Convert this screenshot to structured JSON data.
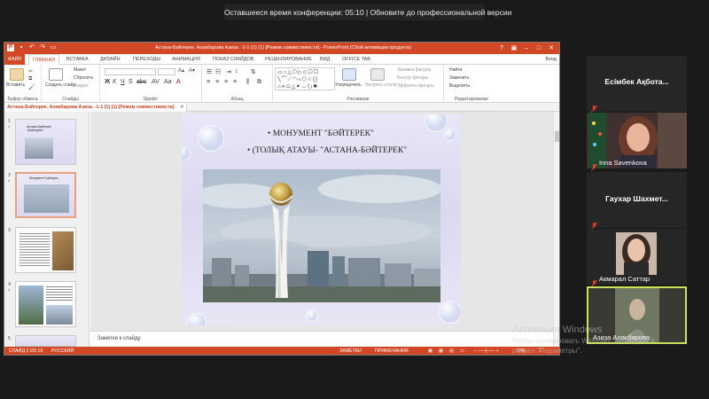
{
  "conference": {
    "banner": "Оставшееся время конференции: 05:10 | Обновите до профессиональной версии"
  },
  "powerpoint": {
    "title": "Астана-Бәйтерек. Алакбарова Азиза. -1-1 (1) (1) [Режим совместимости] - PowerPoint (Сбой активации продукта)",
    "tabs": [
      "ФАЙЛ",
      "ГЛАВНАЯ",
      "ВСТАВКА",
      "ДИЗАЙН",
      "ПЕРЕХОДЫ",
      "АНИМАЦИЯ",
      "ПОКАЗ СЛАЙДОВ",
      "РЕЦЕНЗИРОВАНИЕ",
      "ВИД",
      "OFFICE TAB"
    ],
    "active_tab": "ГЛАВНАЯ",
    "signin": "Вход",
    "ribbon": {
      "paste": "Вставить",
      "new_slide": "Создать слайд",
      "layout": "Макет",
      "reset": "Сбросить",
      "section": "Раздел",
      "arrange": "Упорядочить",
      "quick_styles": "Экспресс-стили",
      "shape_fill": "Заливка фигуры",
      "shape_outline": "Контур фигуры",
      "shape_effects": "Эффекты фигуры",
      "find": "Найти",
      "replace": "Заменить",
      "select": "Выделить",
      "groups": [
        "Буфер обмена",
        "Слайды",
        "Шрифт",
        "Абзац",
        "Рисование",
        "Редактирование"
      ]
    },
    "document_tab": "Астана-Бәйтерек. Алакбарова Азиза. -1-1 (1) (1) [Режим совместимости]",
    "thumbnails": [
      {
        "num": "1",
        "star": "*",
        "caption": "Астана-Байтерек «Бәйтерек»"
      },
      {
        "num": "2",
        "star": "*",
        "caption": "Монумент Бәйтерек"
      },
      {
        "num": "3",
        "star": "",
        "caption": ""
      },
      {
        "num": "4",
        "star": "*",
        "caption": ""
      },
      {
        "num": "5",
        "star": "",
        "caption": ""
      }
    ],
    "slide": {
      "bullet1": "• МОНУМЕНТ \"БӘЙТЕРЕК\"",
      "bullet2": "• (ТОЛЫҚ АТАУЫ- \"АСТАНА-БӘЙТЕРЕК\""
    },
    "notes_placeholder": "Заметки к слайду",
    "status": {
      "slide_info": "СЛАЙД 2 ИЗ 19",
      "language": "РУССКИЙ",
      "notes": "ЗАМЕТКИ",
      "comments": "ПРИМЕЧАНИЯ",
      "zoom": "72%"
    }
  },
  "participants": [
    {
      "name": "Есімбек Ақбота...",
      "muted": true,
      "video": false
    },
    {
      "name": "Inna Savenkova",
      "muted": true,
      "video": true
    },
    {
      "name": "Гаухар Шахмет...",
      "muted": true,
      "video": false
    },
    {
      "name": "Акмарал Саттар",
      "muted": true,
      "video": true
    },
    {
      "name": "Азиза Алакбарова",
      "muted": true,
      "video": true,
      "active_speaker": true
    }
  ],
  "watermark": {
    "title": "Активация Windows",
    "line1": "Чтобы активировать Windows, перейдите в",
    "line2": "раздел \"Параметры\"."
  },
  "colors": {
    "office_orange": "#d24726",
    "background": "#1a1a1a",
    "speaker_border": "#c9e25a",
    "mic_red": "#e23a2f"
  }
}
